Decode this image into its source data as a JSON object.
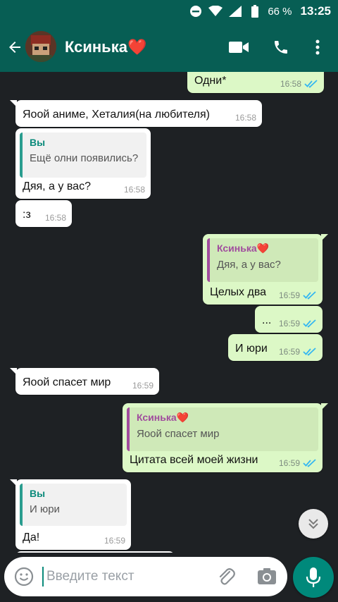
{
  "status_bar": {
    "battery": "66 %",
    "time": "13:25"
  },
  "contact": {
    "name": "Ксинька❤️"
  },
  "messages": [
    {
      "direction": "out",
      "text": "Одни*",
      "time": "16:58",
      "status": "read"
    },
    {
      "direction": "in",
      "text": "Яоой аниме, Хеталия(на любителя)",
      "time": "16:58"
    },
    {
      "direction": "in",
      "quote_author": "Вы",
      "quote_text": "Ещё олни появились?",
      "text": "Дяя, а у вас?",
      "time": "16:58"
    },
    {
      "direction": "in",
      "text": ":з",
      "time": "16:58"
    },
    {
      "direction": "out",
      "quote_author": "Ксинька❤️",
      "quote_text": "Дяя, а у вас?",
      "text": "Целых два",
      "time": "16:59",
      "status": "read"
    },
    {
      "direction": "out",
      "text": "...",
      "time": "16:59",
      "status": "read"
    },
    {
      "direction": "out",
      "text": "И юри",
      "time": "16:59",
      "status": "read"
    },
    {
      "direction": "in",
      "text": "Яоой спасет мир",
      "time": "16:59"
    },
    {
      "direction": "out",
      "quote_author": "Ксинька❤️",
      "quote_text": "Яоой спасет мир",
      "text": "Цитата всей моей жизни",
      "time": "16:59",
      "status": "read"
    },
    {
      "direction": "in",
      "quote_author": "Вы",
      "quote_text": "И юри",
      "text": "Да!",
      "time": "16:59"
    }
  ],
  "composer": {
    "placeholder": "Введите текст"
  },
  "colors": {
    "header": "#075e54",
    "outgoing": "#dcf8c6",
    "incoming": "#ffffff",
    "background": "#1e2124",
    "read_ticks": "#34b7f1",
    "mic_button": "#00897b"
  }
}
